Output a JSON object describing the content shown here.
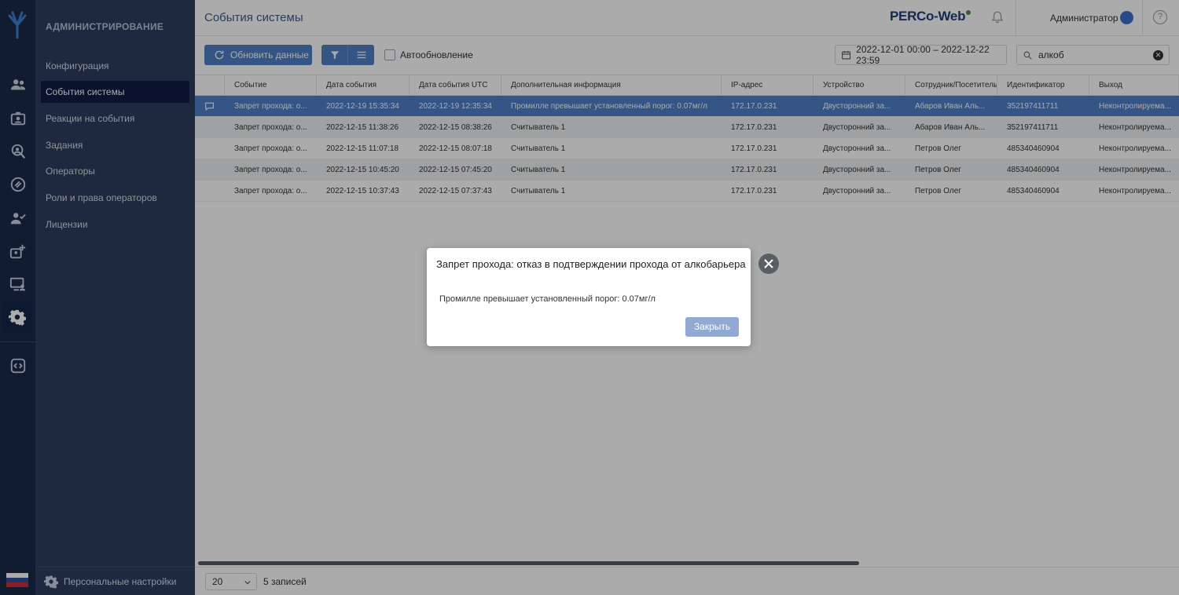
{
  "sidebar": {
    "section_title": "АДМИНИСТРИРОВАНИЕ",
    "items": [
      {
        "label": "Конфигурация"
      },
      {
        "label": "События системы"
      },
      {
        "label": "Реакции на события"
      },
      {
        "label": "Задания"
      },
      {
        "label": "Операторы"
      },
      {
        "label": "Роли и права операторов"
      },
      {
        "label": "Лицензии"
      }
    ],
    "active_item": "События системы",
    "footer_label": "Персональные настройки"
  },
  "rail_icons": [
    "users-icon",
    "id-badge-icon",
    "location-person-icon",
    "link-icon",
    "user-check-icon",
    "user-add-icon",
    "monitor-user-icon",
    "gear-icon",
    "code-icon"
  ],
  "header": {
    "page_title": "События системы",
    "brand": "PERCo-Web",
    "user_name": "Администратор",
    "help_glyph": "?"
  },
  "toolbar": {
    "refresh_label": "Обновить данные",
    "autorefresh_label": "Автообновление",
    "date_range": "2022-12-01 00:00 – 2022-12-22 23:59",
    "search_value": "алкоб"
  },
  "table": {
    "columns": [
      "Событие",
      "Дата события",
      "Дата события UTC",
      "Дополнительная информация",
      "IP-адрес",
      "Устройство",
      "Сотрудник/Посетитель",
      "Идентификатор",
      "Выход"
    ],
    "rows": [
      {
        "cells": [
          "Запрет прохода: о...",
          "2022-12-19 15:35:34",
          "2022-12-19 12:35:34",
          "Промилле превышает установленный порог: 0.07мг/л",
          "172.17.0.231",
          "Двусторонний за...",
          "Абаров Иван Аль...",
          "352197411711",
          "Неконтролируема..."
        ]
      },
      {
        "cells": [
          "Запрет прохода: о...",
          "2022-12-15 11:38:26",
          "2022-12-15 08:38:26",
          "Считыватель 1",
          "172.17.0.231",
          "Двусторонний за...",
          "Абаров Иван Аль...",
          "352197411711",
          "Неконтролируема..."
        ]
      },
      {
        "cells": [
          "Запрет прохода: о...",
          "2022-12-15 11:07:18",
          "2022-12-15 08:07:18",
          "Считыватель 1",
          "172.17.0.231",
          "Двусторонний за...",
          "Петров Олег",
          "485340460904",
          "Неконтролируема..."
        ]
      },
      {
        "cells": [
          "Запрет прохода: о...",
          "2022-12-15 10:45:20",
          "2022-12-15 07:45:20",
          "Считыватель 1",
          "172.17.0.231",
          "Двусторонний за...",
          "Петров Олег",
          "485340460904",
          "Неконтролируема..."
        ]
      },
      {
        "cells": [
          "Запрет прохода: о...",
          "2022-12-15 10:37:43",
          "2022-12-15 07:37:43",
          "Считыватель 1",
          "172.17.0.231",
          "Двусторонний за...",
          "Петров Олег",
          "485340460904",
          "Неконтролируема..."
        ]
      }
    ]
  },
  "footer": {
    "page_size": "20",
    "records": "5 записей"
  },
  "dialog": {
    "title": "Запрет прохода: отказ в подтверждении прохода от алкобарьера",
    "message": "Промилле превышает установленный порог: 0.07мг/л",
    "close_label": "Закрыть"
  },
  "colors": {
    "rail": "#1c2a4a",
    "sidebar": "#2e3d5e",
    "accent": "#4f7fc6",
    "selected_row": "#4f7fc6",
    "brand": "#1f3d78"
  }
}
